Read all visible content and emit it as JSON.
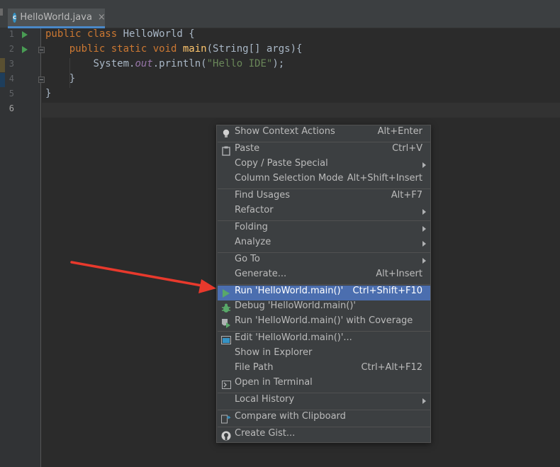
{
  "tab": {
    "icon_letter": "c",
    "filename": "HelloWorld.java",
    "close": "×"
  },
  "gutter": {
    "line_numbers": [
      "1",
      "2",
      "3",
      "4",
      "5",
      "6"
    ]
  },
  "code": {
    "line1": {
      "kw": "public class ",
      "name": "HelloWorld",
      "rest": " {"
    },
    "line2": {
      "kw": "public static void ",
      "fn": "main",
      "rest": "(String[] args){"
    },
    "line3": {
      "obj": "System.",
      "field": "out",
      "call": ".println(",
      "str": "\"Hello IDE\"",
      "end": ");"
    },
    "line4": "}",
    "line5": "}"
  },
  "menu": {
    "items": [
      {
        "label": "Show Context Actions",
        "shortcut": "Alt+Enter",
        "icon": "bulb-icon"
      },
      {
        "label": "Paste",
        "shortcut": "Ctrl+V",
        "icon": "clipboard-icon"
      },
      {
        "label": "Copy / Paste Special",
        "shortcut": "",
        "submenu": true
      },
      {
        "label": "Column Selection Mode",
        "shortcut": "Alt+Shift+Insert"
      },
      {
        "label": "Find Usages",
        "shortcut": "Alt+F7"
      },
      {
        "label": "Refactor",
        "shortcut": "",
        "submenu": true
      },
      {
        "label": "Folding",
        "shortcut": "",
        "submenu": true
      },
      {
        "label": "Analyze",
        "shortcut": "",
        "submenu": true
      },
      {
        "label": "Go To",
        "shortcut": "",
        "submenu": true
      },
      {
        "label": "Generate...",
        "shortcut": "Alt+Insert"
      },
      {
        "label": "Run 'HelloWorld.main()'",
        "shortcut": "Ctrl+Shift+F10",
        "icon": "run-icon",
        "selected": true
      },
      {
        "label": "Debug 'HelloWorld.main()'",
        "shortcut": "",
        "icon": "debug-icon"
      },
      {
        "label": "Run 'HelloWorld.main()' with Coverage",
        "shortcut": "",
        "icon": "coverage-icon"
      },
      {
        "label": "Edit 'HelloWorld.main()'...",
        "shortcut": "",
        "icon": "edit-config-icon"
      },
      {
        "label": "Show in Explorer",
        "shortcut": ""
      },
      {
        "label": "File Path",
        "shortcut": "Ctrl+Alt+F12"
      },
      {
        "label": "Open in Terminal",
        "shortcut": "",
        "icon": "terminal-icon"
      },
      {
        "label": "Local History",
        "shortcut": "",
        "submenu": true
      },
      {
        "label": "Compare with Clipboard",
        "shortcut": "",
        "icon": "compare-icon"
      },
      {
        "label": "Create Gist...",
        "shortcut": "",
        "icon": "github-icon"
      }
    ]
  },
  "colors": {
    "editor_bg": "#2b2b2b",
    "menu_bg": "#3c3f41",
    "selection": "#4b6eaf",
    "keyword": "#cc7832",
    "function": "#ffc66d",
    "string": "#6a8759",
    "arrow": "#e8392c"
  }
}
